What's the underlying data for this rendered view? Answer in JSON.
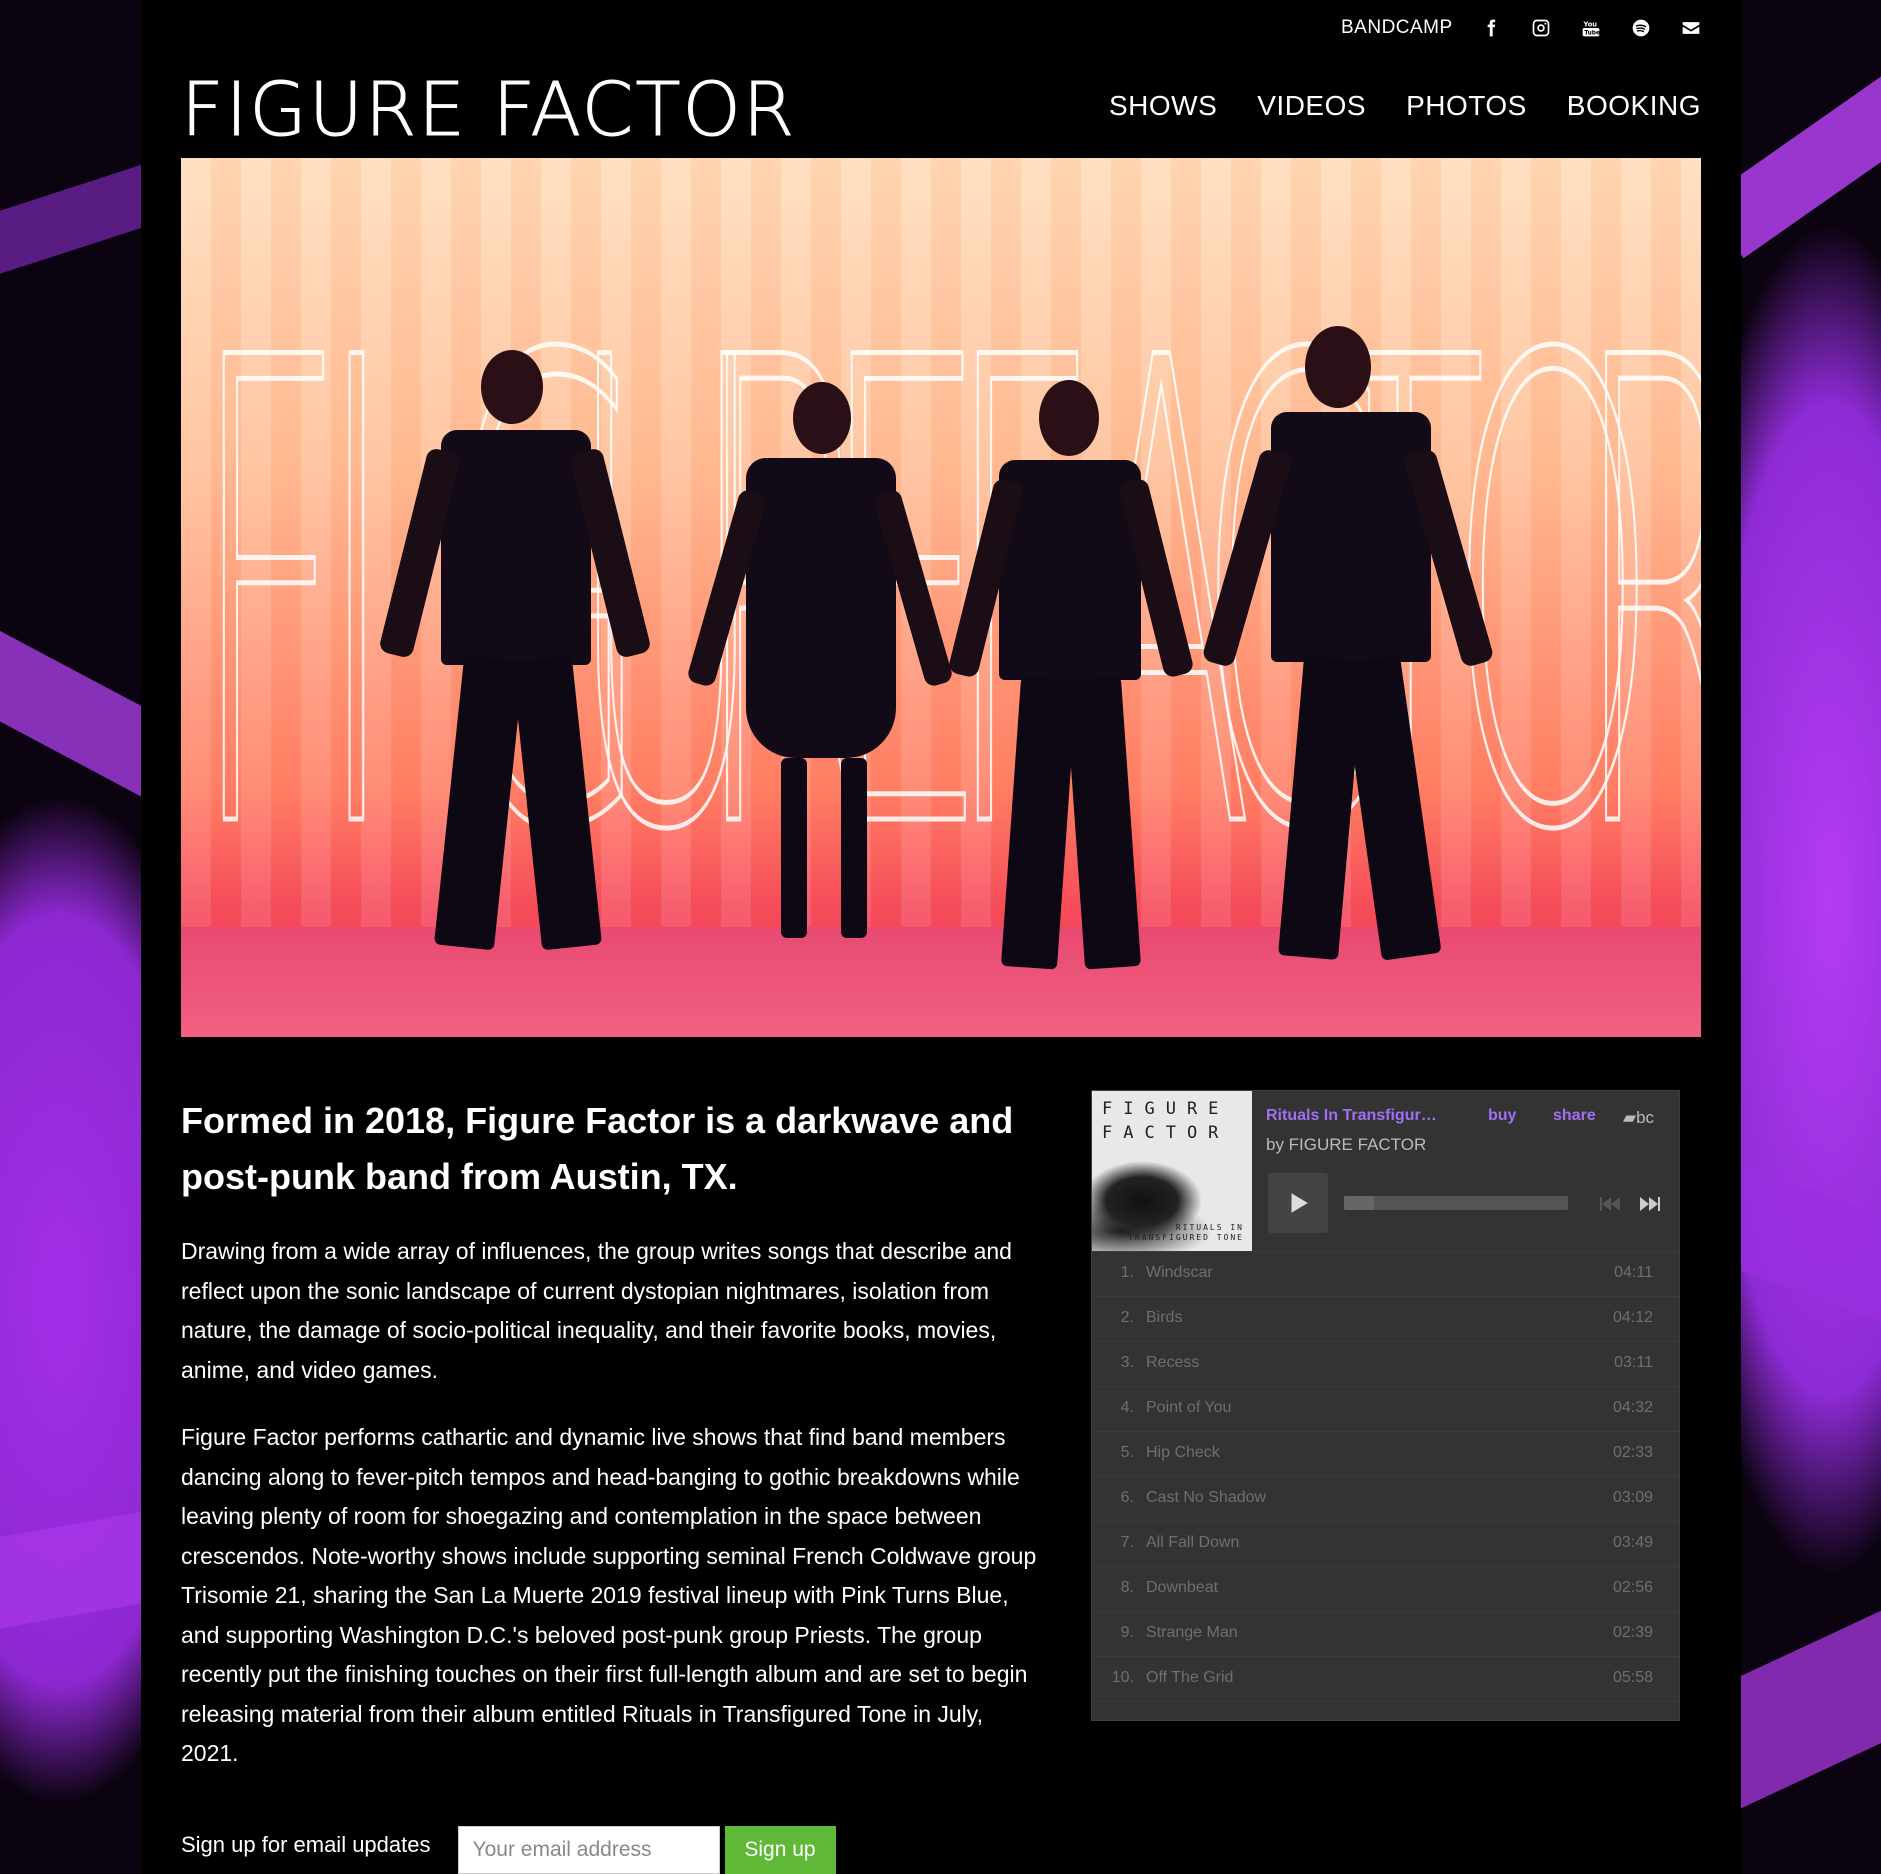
{
  "topbar": {
    "bandcamp_label": "BANDCAMP",
    "icons": [
      "facebook-icon",
      "instagram-icon",
      "youtube-icon",
      "spotify-icon",
      "email-icon"
    ]
  },
  "header": {
    "logo_text": "FIGURE FACTOR",
    "nav": [
      "SHOWS",
      "VIDEOS",
      "PHOTOS",
      "BOOKING"
    ]
  },
  "hero": {
    "overlay_text": "FIGURE FACTOR"
  },
  "main": {
    "lead": "Formed in 2018, Figure Factor is a darkwave and post-punk band from Austin, TX.",
    "paragraph_1": "Drawing from a wide array of influences, the group writes songs that describe and reflect upon the sonic landscape of current dystopian nightmares, isolation from nature, the damage of socio-political inequality, and their favorite books, movies, anime, and video games.",
    "paragraph_2": "Figure Factor performs cathartic and dynamic live shows that find band members dancing along to fever-pitch tempos and head-banging to gothic breakdowns while leaving plenty of room for shoegazing and contemplation in the space between crescendos. Note-worthy shows include supporting seminal French Coldwave group Trisomie 21, sharing the San La Muerte 2019 festival lineup with Pink Turns Blue, and supporting Washington D.C.'s beloved post-punk group Priests. The group recently put the finishing touches on their first full-length album and are set to begin releasing material from their album entitled Rituals in Transfigured Tone in July, 2021."
  },
  "signup": {
    "label": "Sign up for email updates",
    "placeholder": "Your email address",
    "button": "Sign up"
  },
  "player": {
    "album_title": "Rituals In Transfigur…",
    "buy": "buy",
    "share": "share",
    "bc_logo": "bc",
    "by": "by FIGURE FACTOR",
    "art_top": "FIGURE FACTOR",
    "art_sub": "RITUALS IN TRANSFIGURED TONE",
    "accent_color": "#a16ff2",
    "progress": 0,
    "tracks": [
      {
        "num": "1.",
        "title": "Windscar",
        "duration": "04:11"
      },
      {
        "num": "2.",
        "title": "Birds",
        "duration": "04:12"
      },
      {
        "num": "3.",
        "title": "Recess",
        "duration": "03:11"
      },
      {
        "num": "4.",
        "title": "Point of You",
        "duration": "04:32"
      },
      {
        "num": "5.",
        "title": "Hip Check",
        "duration": "02:33"
      },
      {
        "num": "6.",
        "title": "Cast No Shadow",
        "duration": "03:09"
      },
      {
        "num": "7.",
        "title": "All Fall Down",
        "duration": "03:49"
      },
      {
        "num": "8.",
        "title": "Downbeat",
        "duration": "02:56"
      },
      {
        "num": "9.",
        "title": "Strange Man",
        "duration": "02:39"
      },
      {
        "num": "10.",
        "title": "Off The Grid",
        "duration": "05:58"
      }
    ]
  },
  "colors": {
    "background_purple": "#a22ee8",
    "signup_button": "#60b936"
  }
}
